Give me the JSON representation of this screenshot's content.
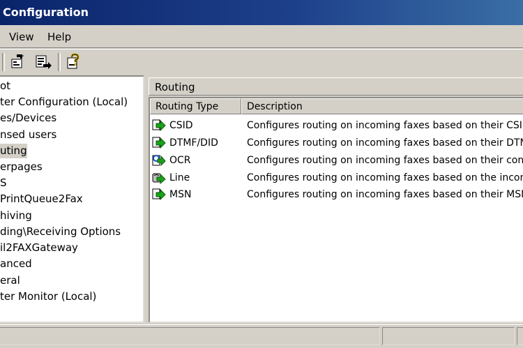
{
  "window": {
    "title": "Configuration"
  },
  "menu": {
    "items": [
      "View",
      "Help"
    ]
  },
  "toolbar": {
    "buttons": [
      "properties-icon",
      "export-list-icon",
      "help-icon"
    ]
  },
  "tree": {
    "items": [
      {
        "label": "ot"
      },
      {
        "label": "ter Configuration (Local)"
      },
      {
        "label": "es/Devices"
      },
      {
        "label": "nsed users"
      },
      {
        "label": "uting"
      },
      {
        "label": "erpages"
      },
      {
        "label": "S"
      },
      {
        "label": "PrintQueue2Fax"
      },
      {
        "label": "hiving"
      },
      {
        "label": "ding\\Receiving Options"
      },
      {
        "label": "il2FAXGateway"
      },
      {
        "label": "anced"
      },
      {
        "label": "eral"
      },
      {
        "label": "ter Monitor (Local)"
      }
    ],
    "selected_index": 4
  },
  "right_pane": {
    "header": "Routing",
    "columns": [
      "Routing Type",
      "Description"
    ],
    "rows": [
      {
        "type": "CSID",
        "description": "Configures routing on incoming faxes based on their CSID",
        "icon": "green-arrow-fax-icon"
      },
      {
        "type": "DTMF/DID",
        "description": "Configures routing on incoming faxes based on their DTMF",
        "icon": "green-arrow-fax-icon"
      },
      {
        "type": "OCR",
        "description": "Configures routing on incoming faxes based on their content",
        "icon": "ocr-fax-icon"
      },
      {
        "type": "Line",
        "description": "Configures routing on incoming faxes based on the incoming line",
        "icon": "line-fax-icon"
      },
      {
        "type": "MSN",
        "description": "Configures routing on incoming faxes based on their MSN",
        "icon": "green-arrow-fax-icon"
      }
    ]
  },
  "colors": {
    "title_bar": "#0a246a",
    "chrome": "#d4d0c8",
    "pane_bg": "#ffffff",
    "arrow_green": "#1aa31a"
  }
}
